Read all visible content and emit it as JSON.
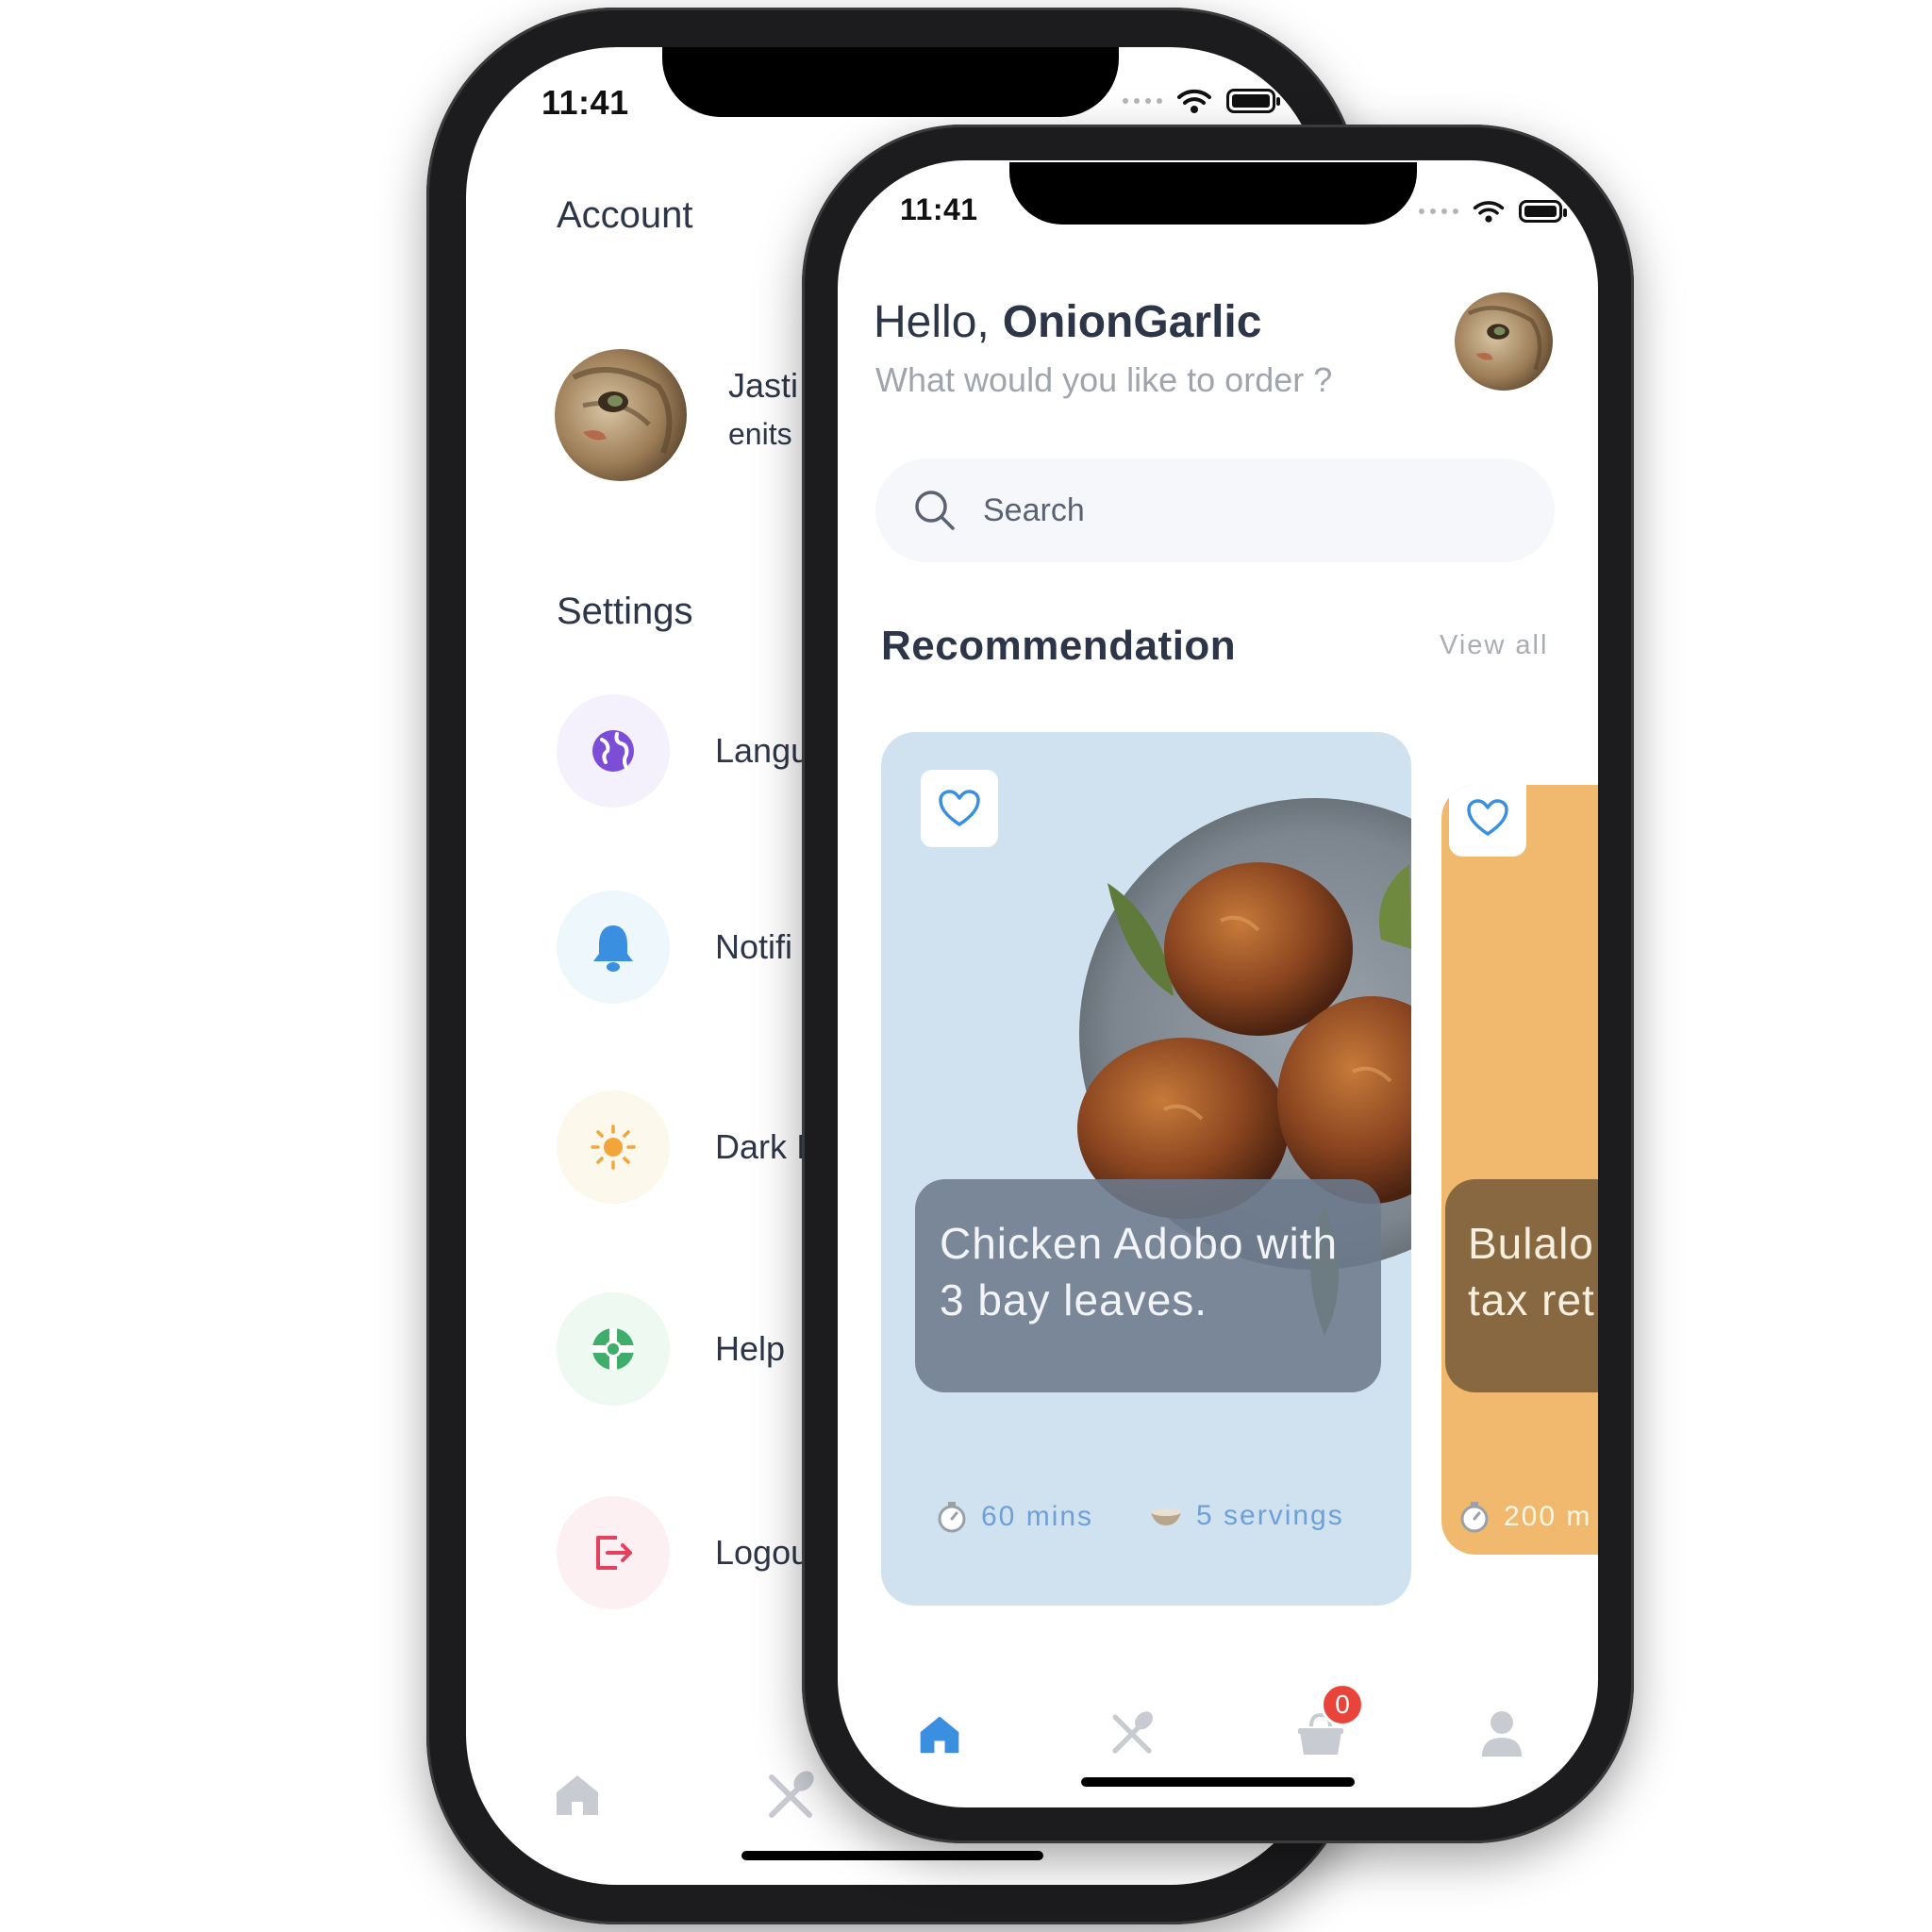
{
  "status_bar": {
    "time": "11:41"
  },
  "account_screen": {
    "title": "Account",
    "user": {
      "name": "Jasti",
      "email": "enits"
    },
    "settings_title": "Settings",
    "settings_items": [
      {
        "label": "Langu",
        "icon": "globe-icon",
        "color": "#7c4dd6"
      },
      {
        "label": "Notifi",
        "icon": "bell-icon",
        "color": "#3a8fe0"
      },
      {
        "label": "Dark I",
        "icon": "sun-icon",
        "color": "#f3a53a"
      },
      {
        "label": "Help",
        "icon": "lifebuoy-icon",
        "color": "#3fae6a"
      },
      {
        "label": "Logou",
        "icon": "logout-icon",
        "color": "#e6405f"
      }
    ]
  },
  "home_screen": {
    "greeting": "Hello,",
    "username": "OnionGarlic",
    "subtitle": "What would you like to order ?",
    "search": {
      "placeholder": "Search"
    },
    "section": {
      "title": "Recommendation",
      "view_all": "View all"
    },
    "recipes": [
      {
        "title": "Chicken Adobo with 3 bay leaves.",
        "time": "60 mins",
        "servings": "5 servings",
        "color": "#d0e2f0",
        "favorite": false
      },
      {
        "title": "Bulalo tax ret",
        "time": "200 m",
        "color": "#f1b96d",
        "favorite": false
      }
    ],
    "tabs": [
      {
        "name": "home",
        "icon": "home-icon",
        "active": true
      },
      {
        "name": "recipes",
        "icon": "utensils-icon",
        "active": false
      },
      {
        "name": "cart",
        "icon": "cart-icon",
        "badge": "0",
        "active": false
      },
      {
        "name": "profile",
        "icon": "user-icon",
        "active": false
      }
    ],
    "active_color": "#3a8fe0",
    "inactive_color": "#c8cbd1"
  }
}
